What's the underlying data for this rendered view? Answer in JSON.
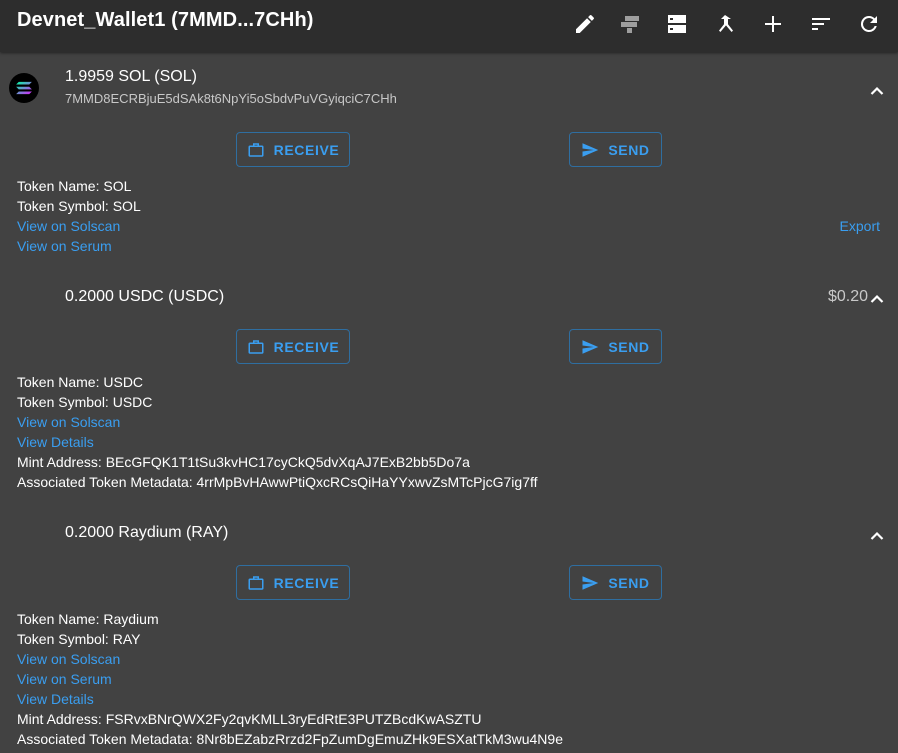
{
  "header": {
    "title": "Devnet_Wallet1 (7MMD...7CHh)",
    "tools": [
      "pencil-icon",
      "flag-icon",
      "server-icon",
      "merge-icon",
      "plus-icon",
      "sort-icon",
      "refresh-icon"
    ]
  },
  "colors": {
    "accent": "#3a9ef0",
    "background": "#424242",
    "appbar": "#2d2d2d"
  },
  "tokens": [
    {
      "balance": "1.9959 SOL (SOL)",
      "address": "7MMD8ECRBjuE5dSAk8t6NpYi5oSbdvPuVGyiqciC7CHh",
      "receive_label": "RECEIVE",
      "send_label": "SEND",
      "name_line": "Token Name: SOL",
      "symbol_line": "Token Symbol: SOL",
      "solscan_link": "View on Solscan",
      "serum_link": "View on Serum",
      "export_label": "Export"
    },
    {
      "balance": "0.2000 USDC (USDC)",
      "value": "$0.20",
      "receive_label": "RECEIVE",
      "send_label": "SEND",
      "name_line": "Token Name: USDC",
      "symbol_line": "Token Symbol: USDC",
      "solscan_link": "View on Solscan",
      "details_link": "View Details",
      "mint_line": "Mint Address: BEcGFQK1T1tSu3kvHC17cyCkQ5dvXqAJ7ExB2bb5Do7a",
      "metadata_line": "Associated Token Metadata: 4rrMpBvHAwwPtiQxcRCsQiHaYYxwvZsMTcPjcG7ig7ff"
    },
    {
      "balance": "0.2000 Raydium (RAY)",
      "receive_label": "RECEIVE",
      "send_label": "SEND",
      "name_line": "Token Name: Raydium",
      "symbol_line": "Token Symbol: RAY",
      "solscan_link": "View on Solscan",
      "serum_link": "View on Serum",
      "details_link": "View Details",
      "mint_line": "Mint Address: FSRvxBNrQWX2Fy2qvKMLL3ryEdRtE3PUTZBcdKwASZTU",
      "metadata_line": "Associated Token Metadata: 8Nr8bEZabzRrzd2FpZumDgEmuZHk9ESXatTkM3wu4N9e"
    }
  ]
}
